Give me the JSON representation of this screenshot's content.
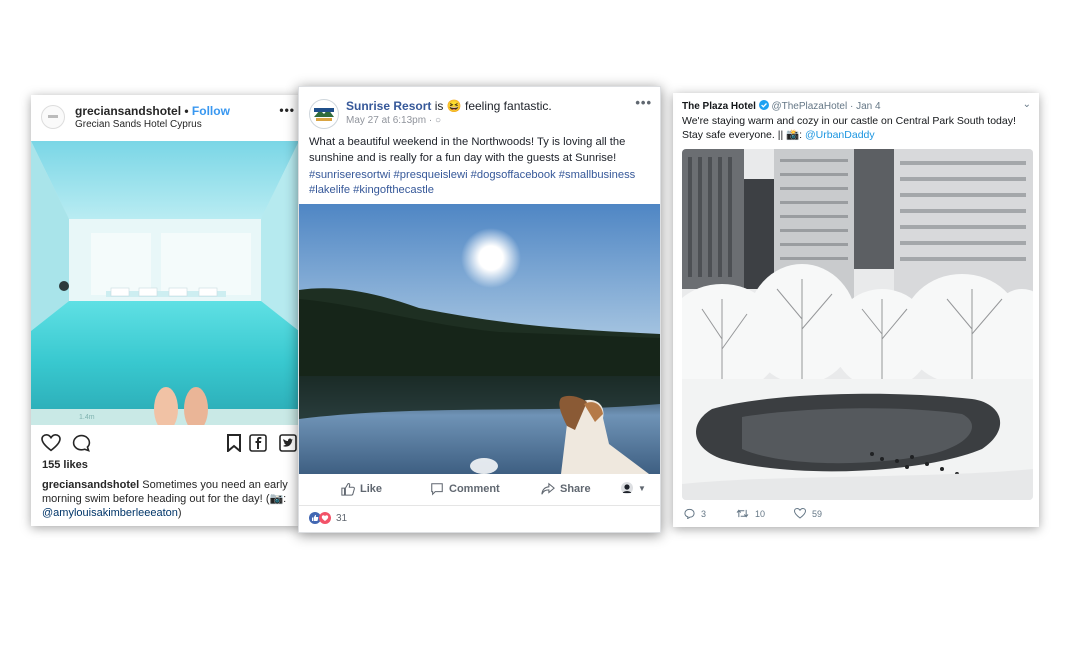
{
  "instagram": {
    "username": "greciansandshotel",
    "separator": "•",
    "follow": "Follow",
    "location": "Grecian Sands Hotel Cyprus",
    "more": "•••",
    "likes": "155 likes",
    "caption_user": "greciansandshotel",
    "caption_text": " Sometimes you need an early morning swim before heading out for the day!",
    "caption_credit": "(📷: ",
    "caption_mention": "@amylouisakimberleeeaton",
    "caption_end": ")"
  },
  "facebook": {
    "page_name": "Sunrise Resort",
    "is": " is ",
    "feeling_emoji": "😆",
    "feeling": " feeling fantastic.",
    "date": "May 27 at 6:13pm · ",
    "more": "•••",
    "post_text": "What a beautiful weekend in the Northwoods! Ty is loving all the sunshine and is really for a fun day with the guests at Sunrise!",
    "hashtags": "#sunriseresortwi #presqueislewi #dogsoffacebook #smallbusiness #lakelife #kingofthecastle",
    "like": "Like",
    "comment": "Comment",
    "share": "Share",
    "reactions_count": "31",
    "colors": {
      "link": "#365899",
      "like_blue": "#4267b2",
      "love_red": "#f25268"
    }
  },
  "twitter": {
    "name": "The Plaza Hotel",
    "handle": "@ThePlazaHotel",
    "dot": " · ",
    "date": "Jan 4",
    "text": "We're staying warm and cozy in our castle on Central Park South today! Stay safe everyone. || 📸: ",
    "mention": "@UrbanDaddy",
    "replies": "3",
    "retweets": "10",
    "likes": "59",
    "colors": {
      "verified": "#1da1f2",
      "mention": "#1b95e0"
    }
  }
}
